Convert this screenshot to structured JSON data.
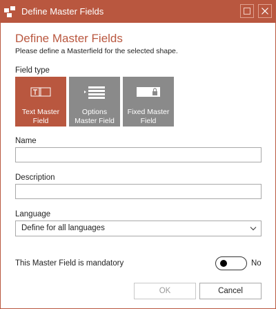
{
  "window": {
    "title": "Define Master Fields"
  },
  "header": {
    "heading": "Define Master Fields",
    "subheading": "Please define a Masterfield for the selected shape."
  },
  "field_type": {
    "label": "Field type",
    "options": [
      {
        "label": "Text Master Field",
        "icon": "text-field-icon",
        "selected": true
      },
      {
        "label": "Options Master Field",
        "icon": "options-list-icon",
        "selected": false
      },
      {
        "label": "Fixed Master Field",
        "icon": "locked-field-icon",
        "selected": false
      }
    ]
  },
  "name": {
    "label": "Name",
    "value": ""
  },
  "description": {
    "label": "Description",
    "value": ""
  },
  "language": {
    "label": "Language",
    "selected": "Define for all languages"
  },
  "mandatory": {
    "label": "This Master Field is mandatory",
    "state": "No",
    "on": false
  },
  "buttons": {
    "ok": "OK",
    "cancel": "Cancel"
  },
  "colors": {
    "accent": "#b9573f",
    "tile_inactive": "#8a8a8a"
  }
}
